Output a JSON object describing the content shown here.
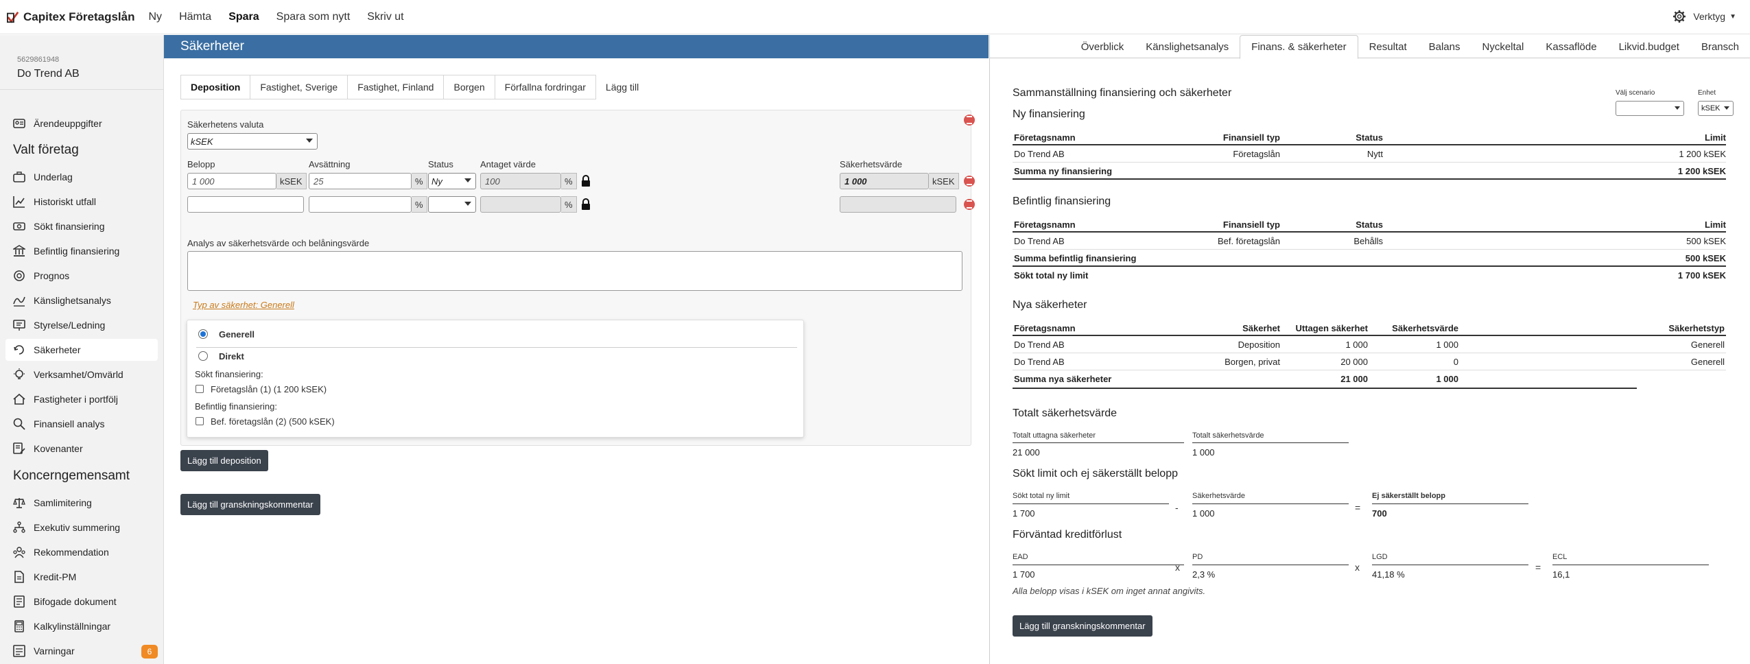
{
  "topbar": {
    "brand": "Capitex Företagslån",
    "menu": [
      "Ny",
      "Hämta",
      "Spara",
      "Spara som nytt",
      "Skriv ut"
    ],
    "active_menu": "Spara",
    "tools_label": "Verktyg"
  },
  "sidebar": {
    "org_number": "5629861948",
    "company_name": "Do Trend AB",
    "items": {
      "arende": "Ärendeuppgifter",
      "valt_foretag": "Valt företag",
      "underlag": "Underlag",
      "historiskt": "Historiskt utfall",
      "sokt": "Sökt finansiering",
      "befintlig": "Befintlig finansiering",
      "prognos": "Prognos",
      "kanslighet": "Känslighetsanalys",
      "styrelse": "Styrelse/Ledning",
      "sakerheter": "Säkerheter",
      "verksamhet": "Verksamhet/Omvärld",
      "fastigheter": "Fastigheter i portfölj",
      "finansiell": "Finansiell analys",
      "kovenanter": "Kovenanter",
      "koncern": "Koncerngemensamt",
      "samlimitering": "Samlimitering",
      "exekutiv": "Exekutiv summering",
      "rekommendation": "Rekommendation",
      "kreditpm": "Kredit-PM",
      "bifogade": "Bifogade dokument",
      "kalkyl": "Kalkylinställningar",
      "varningar": "Varningar"
    },
    "warnings_count": "6"
  },
  "mid": {
    "title": "Säkerheter",
    "tabs": [
      "Deposition",
      "Fastighet, Sverige",
      "Fastighet, Finland",
      "Borgen",
      "Förfallna fordringar"
    ],
    "add_tab": "Lägg till",
    "currency_label": "Säkerhetens valuta",
    "currency_value": "kSEK",
    "col_belopp": "Belopp",
    "col_avsattning": "Avsättning",
    "col_status": "Status",
    "col_antaget": "Antaget värde",
    "col_sakerhetsvarde": "Säkerhetsvärde",
    "row1": {
      "belopp": "1 000",
      "unit": "kSEK",
      "avsattning": "25",
      "pct": "%",
      "status": "Ny",
      "antaget": "100",
      "pct2": "%",
      "sakerhetsvarde": "1 000",
      "unit2": "kSEK"
    },
    "row2": {
      "pct": "%",
      "pct2": "%"
    },
    "analysis_label": "Analys av säkerhetsvärde och belåningsvärde",
    "type_link": "Typ av säkerhet: Generell",
    "popup": {
      "opt_generell": "Generell",
      "opt_direkt": "Direkt",
      "sokt_label": "Sökt finansiering:",
      "sokt_item": "Företagslån (1) (1 200 kSEK)",
      "bef_label": "Befintlig finansiering:",
      "bef_item": "Bef. företagslån (2) (500 kSEK)"
    },
    "btn_add_deposition": "Lägg till deposition",
    "btn_add_comment": "Lägg till granskningskommentar"
  },
  "right": {
    "tabs": [
      "Överblick",
      "Känslighetsanalys",
      "Finans. & säkerheter",
      "Resultat",
      "Balans",
      "Nyckeltal",
      "Kassaflöde",
      "Likvid.budget",
      "Bransch"
    ],
    "active_tab": "Finans. & säkerheter",
    "title": "Sammanställning finansiering och säkerheter",
    "scenario_label": "Välj scenario",
    "scenario_value": "",
    "unit_label": "Enhet",
    "unit_value": "kSEK",
    "ny_fin": {
      "title": "Ny finansiering",
      "headers": [
        "Företagsnamn",
        "Finansiell typ",
        "Status",
        "Limit"
      ],
      "rows": [
        [
          "Do Trend AB",
          "Företagslån",
          "Nytt",
          "1 200 kSEK"
        ]
      ],
      "sum_label": "Summa ny finansiering",
      "sum_value": "1 200 kSEK"
    },
    "bef_fin": {
      "title": "Befintlig finansiering",
      "headers": [
        "Företagsnamn",
        "Finansiell typ",
        "Status",
        "Limit"
      ],
      "rows": [
        [
          "Do Trend AB",
          "Bef. företagslån",
          "Behålls",
          "500 kSEK"
        ]
      ],
      "sum_label": "Summa befintlig finansiering",
      "sum_value": "500 kSEK",
      "total_label": "Sökt total ny limit",
      "total_value": "1 700 kSEK"
    },
    "nya_sak": {
      "title": "Nya säkerheter",
      "headers": [
        "Företagsnamn",
        "Säkerhet",
        "Uttagen säkerhet",
        "Säkerhetsvärde",
        "Säkerhetstyp"
      ],
      "rows": [
        [
          "Do Trend AB",
          "Deposition",
          "1 000",
          "1 000",
          "Generell"
        ],
        [
          "Do Trend AB",
          "Borgen, privat",
          "20 000",
          "0",
          "Generell"
        ]
      ],
      "sum_label": "Summa nya säkerheter",
      "sum_uttagen": "21 000",
      "sum_varde": "1 000"
    },
    "totalt": {
      "title": "Totalt säkerhetsvärde",
      "f1_label": "Totalt uttagna säkerheter",
      "f1_value": "21 000",
      "f2_label": "Totalt säkerhetsvärde",
      "f2_value": "1 000"
    },
    "sokt_limit": {
      "title": "Sökt limit och ej säkerställt belopp",
      "f1_label": "Sökt total ny limit",
      "f1_value": "1 700",
      "op1": "-",
      "f2_label": "Säkerhetsvärde",
      "f2_value": "1 000",
      "op2": "=",
      "f3_label": "Ej säkerställt belopp",
      "f3_value": "700"
    },
    "ecl": {
      "title": "Förväntad kreditförlust",
      "ead_label": "EAD",
      "ead_value": "1 700",
      "pd_label": "PD",
      "pd_value": "2,3 %",
      "lgd_label": "LGD",
      "lgd_value": "41,18 %",
      "ecl_label": "ECL",
      "ecl_value": "16,1",
      "op_x1": "x",
      "op_x2": "x",
      "op_eq": "="
    },
    "note": "Alla belopp visas i kSEK om inget annat angivits.",
    "btn_comment": "Lägg till granskningskommentar"
  }
}
